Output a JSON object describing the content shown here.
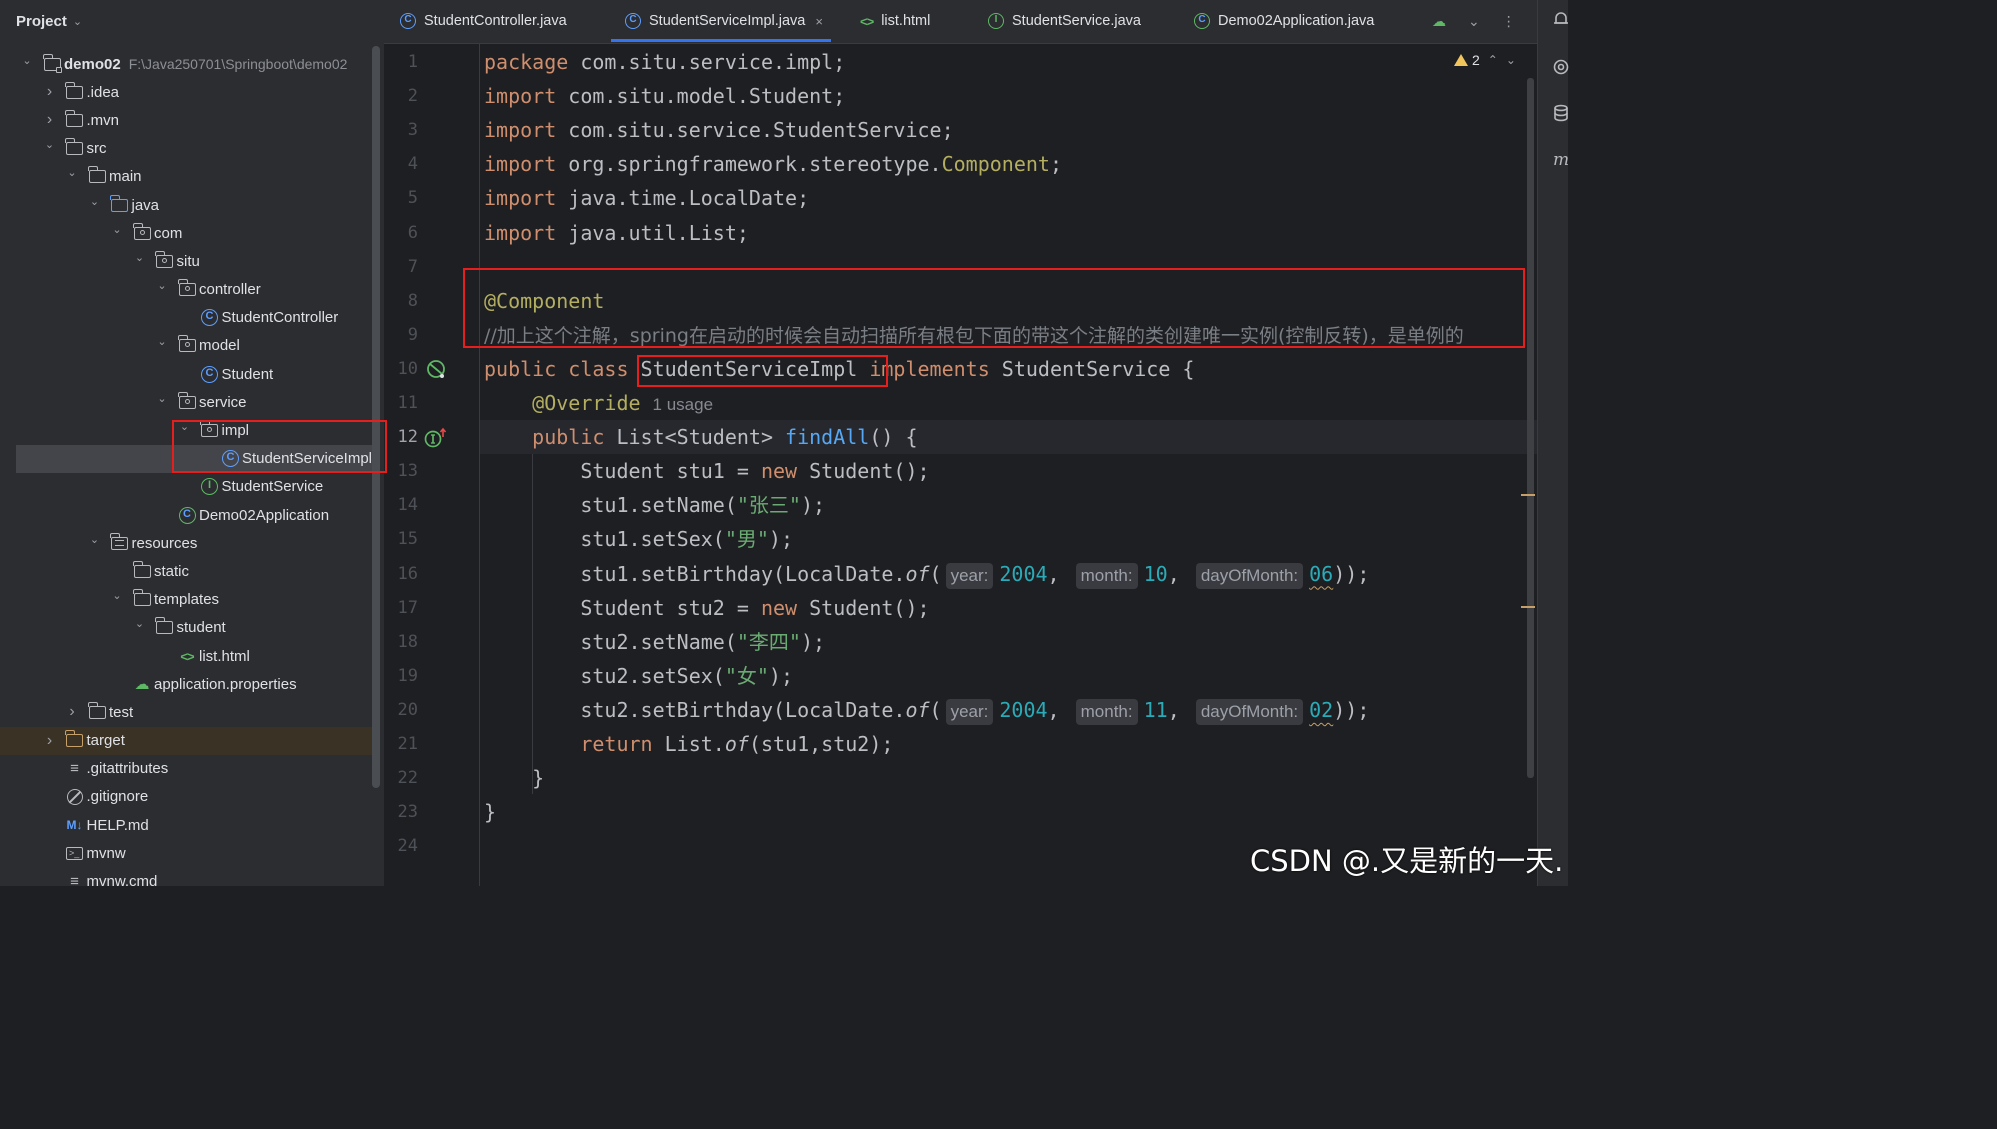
{
  "project_panel": {
    "title": "Project",
    "tree": [
      {
        "label": "demo02",
        "path": "F:\\Java250701\\Springboot\\demo02",
        "depth": 0,
        "chevron": "down",
        "icon": "module-folder-icon",
        "bold": true
      },
      {
        "label": ".idea",
        "depth": 1,
        "chevron": "right",
        "icon": "folder-icon"
      },
      {
        "label": ".mvn",
        "depth": 1,
        "chevron": "right",
        "icon": "folder-icon"
      },
      {
        "label": "src",
        "depth": 1,
        "chevron": "down",
        "icon": "folder-icon"
      },
      {
        "label": "main",
        "depth": 2,
        "chevron": "down",
        "icon": "folder-icon"
      },
      {
        "label": "java",
        "depth": 3,
        "chevron": "down",
        "icon": "source-folder-icon"
      },
      {
        "label": "com",
        "depth": 4,
        "chevron": "down",
        "icon": "package-icon"
      },
      {
        "label": "situ",
        "depth": 5,
        "chevron": "down",
        "icon": "package-icon"
      },
      {
        "label": "controller",
        "depth": 6,
        "chevron": "down",
        "icon": "package-icon"
      },
      {
        "label": "StudentController",
        "depth": 7,
        "chevron": "",
        "icon": "class-icon"
      },
      {
        "label": "model",
        "depth": 6,
        "chevron": "down",
        "icon": "package-icon"
      },
      {
        "label": "Student",
        "depth": 7,
        "chevron": "",
        "icon": "class-icon"
      },
      {
        "label": "service",
        "depth": 6,
        "chevron": "down",
        "icon": "package-icon"
      },
      {
        "label": "impl",
        "depth": 7,
        "chevron": "down",
        "icon": "package-icon"
      },
      {
        "label": "StudentServiceImpl",
        "depth": 8,
        "chevron": "",
        "icon": "class-icon",
        "selected": true
      },
      {
        "label": "StudentService",
        "depth": 7,
        "chevron": "",
        "icon": "interface-icon"
      },
      {
        "label": "Demo02Application",
        "depth": 6,
        "chevron": "",
        "icon": "spring-app-icon"
      },
      {
        "label": "resources",
        "depth": 3,
        "chevron": "down",
        "icon": "resources-folder-icon"
      },
      {
        "label": "static",
        "depth": 4,
        "chevron": "",
        "icon": "folder-icon"
      },
      {
        "label": "templates",
        "depth": 4,
        "chevron": "down",
        "icon": "folder-icon"
      },
      {
        "label": "student",
        "depth": 5,
        "chevron": "down",
        "icon": "folder-icon"
      },
      {
        "label": "list.html",
        "depth": 6,
        "chevron": "",
        "icon": "html-icon"
      },
      {
        "label": "application.properties",
        "depth": 4,
        "chevron": "",
        "icon": "properties-icon"
      },
      {
        "label": "test",
        "depth": 2,
        "chevron": "right",
        "icon": "folder-icon"
      },
      {
        "label": "target",
        "depth": 1,
        "chevron": "right",
        "icon": "excluded-folder-icon",
        "highlight": true
      },
      {
        "label": ".gitattributes",
        "depth": 1,
        "chevron": "",
        "icon": "text-file-icon"
      },
      {
        "label": ".gitignore",
        "depth": 1,
        "chevron": "",
        "icon": "ignore-file-icon"
      },
      {
        "label": "HELP.md",
        "depth": 1,
        "chevron": "",
        "icon": "markdown-icon"
      },
      {
        "label": "mvnw",
        "depth": 1,
        "chevron": "",
        "icon": "terminal-file-icon"
      },
      {
        "label": "mvnw.cmd",
        "depth": 1,
        "chevron": "",
        "icon": "text-file-icon"
      }
    ]
  },
  "tabs": [
    {
      "label": "StudentController.java",
      "icon": "class-icon"
    },
    {
      "label": "StudentServiceImpl.java",
      "icon": "class-icon",
      "active": true,
      "close": "×"
    },
    {
      "label": "list.html",
      "icon": "html-icon"
    },
    {
      "label": "StudentService.java",
      "icon": "interface-icon"
    },
    {
      "label": "Demo02Application.java",
      "icon": "spring-app-icon"
    }
  ],
  "inspection": {
    "warnings": "2"
  },
  "editor": {
    "current_line": 12,
    "line_numbers": [
      "1",
      "2",
      "3",
      "4",
      "5",
      "6",
      "7",
      "8",
      "9",
      "10",
      "11",
      "12",
      "13",
      "14",
      "15",
      "16",
      "17",
      "18",
      "19",
      "20",
      "21",
      "22",
      "23",
      "24"
    ],
    "lines": [
      [
        {
          "t": "package ",
          "c": "kw"
        },
        {
          "t": "com.situ.service.impl;"
        }
      ],
      [
        {
          "t": "import ",
          "c": "kw"
        },
        {
          "t": "com.situ.model.Student;"
        }
      ],
      [
        {
          "t": "import ",
          "c": "kw"
        },
        {
          "t": "com.situ.service.StudentService;"
        }
      ],
      [
        {
          "t": "import ",
          "c": "kw"
        },
        {
          "t": "org.springframework.stereotype."
        },
        {
          "t": "Component",
          "c": "ann"
        },
        {
          "t": ";"
        }
      ],
      [
        {
          "t": "import ",
          "c": "kw"
        },
        {
          "t": "java.time.LocalDate;"
        }
      ],
      [
        {
          "t": "import ",
          "c": "kw"
        },
        {
          "t": "java.util.List;"
        }
      ],
      [],
      [
        {
          "t": "@Component",
          "c": "ann"
        }
      ],
      [
        {
          "t": "//加上这个注解，spring在启动的时候会自动扫描所有根包下面的带这个注解的类创建唯一实例(控制反转)，是单例的",
          "c": "cmt"
        }
      ],
      [
        {
          "t": "public ",
          "c": "kw"
        },
        {
          "t": "class ",
          "c": "kw"
        },
        {
          "t": "StudentServiceImpl "
        },
        {
          "t": "implements ",
          "c": "kw"
        },
        {
          "t": "StudentService {"
        }
      ],
      [
        {
          "t": "    "
        },
        {
          "t": "@Override",
          "c": "ann"
        },
        {
          "t": "1 usage",
          "c": "usage"
        }
      ],
      [
        {
          "t": "    "
        },
        {
          "t": "public ",
          "c": "kw"
        },
        {
          "t": "List<Student> "
        },
        {
          "t": "findAll",
          "c": "meth"
        },
        {
          "t": "() {"
        }
      ],
      [
        {
          "t": "        Student stu1 = "
        },
        {
          "t": "new ",
          "c": "kw"
        },
        {
          "t": "Student();"
        }
      ],
      [
        {
          "t": "        stu1.setName("
        },
        {
          "t": "\"张三\"",
          "c": "str"
        },
        {
          "t": ");"
        }
      ],
      [
        {
          "t": "        stu1.setSex("
        },
        {
          "t": "\"男\"",
          "c": "str"
        },
        {
          "t": ");"
        }
      ],
      [
        {
          "t": "        stu1.setBirthday(LocalDate."
        },
        {
          "t": "of",
          "c": "ital"
        },
        {
          "t": "("
        },
        {
          "t": "year:",
          "c": "hint"
        },
        {
          "t": "2004",
          "c": "num"
        },
        {
          "t": ", "
        },
        {
          "t": "month:",
          "c": "hint"
        },
        {
          "t": "10",
          "c": "num"
        },
        {
          "t": ", "
        },
        {
          "t": "dayOfMonth:",
          "c": "hint"
        },
        {
          "t": "06",
          "c": "num wavy"
        },
        {
          "t": "));"
        }
      ],
      [
        {
          "t": "        Student stu2 = "
        },
        {
          "t": "new ",
          "c": "kw"
        },
        {
          "t": "Student();"
        }
      ],
      [
        {
          "t": "        stu2.setName("
        },
        {
          "t": "\"李四\"",
          "c": "str"
        },
        {
          "t": ");"
        }
      ],
      [
        {
          "t": "        stu2.setSex("
        },
        {
          "t": "\"女\"",
          "c": "str"
        },
        {
          "t": ");"
        }
      ],
      [
        {
          "t": "        stu2.setBirthday(LocalDate."
        },
        {
          "t": "of",
          "c": "ital"
        },
        {
          "t": "("
        },
        {
          "t": "year:",
          "c": "hint"
        },
        {
          "t": "2004",
          "c": "num"
        },
        {
          "t": ", "
        },
        {
          "t": "month:",
          "c": "hint"
        },
        {
          "t": "11",
          "c": "num"
        },
        {
          "t": ", "
        },
        {
          "t": "dayOfMonth:",
          "c": "hint"
        },
        {
          "t": "02",
          "c": "num wavy"
        },
        {
          "t": "));"
        }
      ],
      [
        {
          "t": "        "
        },
        {
          "t": "return ",
          "c": "kw"
        },
        {
          "t": "List."
        },
        {
          "t": "of",
          "c": "ital"
        },
        {
          "t": "(stu1,stu2);"
        }
      ],
      [
        {
          "t": "    }"
        }
      ],
      [
        {
          "t": "}"
        }
      ],
      []
    ]
  },
  "watermark": "CSDN @.又是新的一天."
}
